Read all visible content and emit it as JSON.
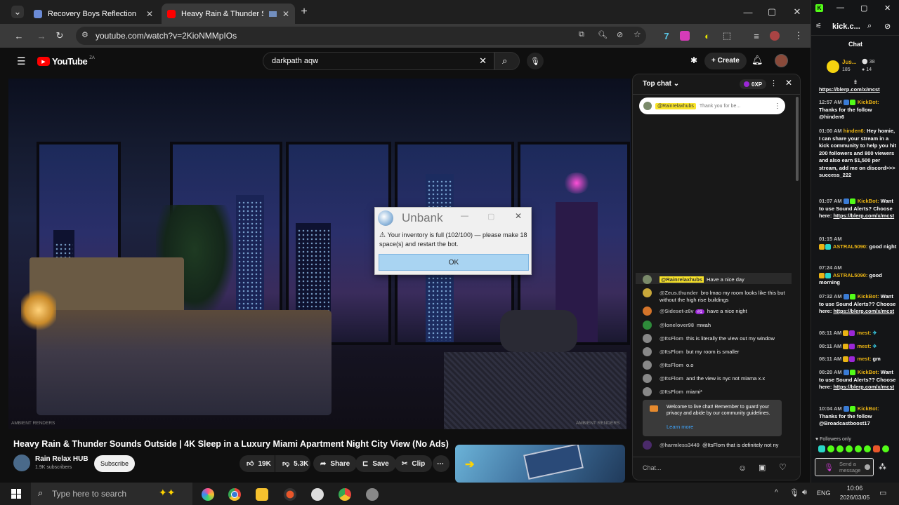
{
  "browser": {
    "tabs": [
      {
        "title": "Recovery Boys Reflection",
        "active": false
      },
      {
        "title": "Heavy Rain & Thunder Sou",
        "active": true
      }
    ],
    "url": "youtube.com/watch?v=2KioNMMpIOs"
  },
  "youtube": {
    "logo": "YouTube",
    "region": "ZA",
    "search_query": "darkpath aqw",
    "create_label": "Create",
    "video_watermark_left": "AMBIENT RENDERS",
    "video_watermark_right": "AMBIENT RENDERS",
    "video_title": "Heavy Rain & Thunder Sounds Outside | 4K Sleep in a Luxury Miami Apartment Night City View (No Ads)",
    "channel_name": "Rain Relax HUB",
    "subscribers": "1.9K subscribers",
    "subscribe_label": "Subscribe",
    "likes": "19K",
    "dislikes": "5.3K",
    "share_label": "Share",
    "save_label": "Save",
    "clip_label": "Clip"
  },
  "livechat": {
    "header": "Top chat",
    "points": "0XP",
    "pinned_user": "@Rainrelaxhubs",
    "pinned_msg": "Thank you for be...",
    "messages": [
      {
        "user": "@Rainrelaxhubs",
        "msg": "Have a nice day",
        "avatar_color": "#7a8a6a"
      },
      {
        "user": "@Zeus.thunder",
        "msg": "bro lmao my room looks like this but without the high rise buildings",
        "avatar_color": "#c9a83a"
      },
      {
        "user": "@Sideset-z6v",
        "msg": "have a nice night",
        "avatar_color": "#d4742a",
        "badge": "#1"
      },
      {
        "user": "@lonelover98",
        "msg": "mwah",
        "avatar_color": "#2e8b3a"
      },
      {
        "user": "@ItsFlom",
        "msg": "this is literally the view out my window",
        "avatar_color": "#888"
      },
      {
        "user": "@ItsFlom",
        "msg": "but my room is smaller",
        "avatar_color": "#888"
      },
      {
        "user": "@ItsFlom",
        "msg": "o.o",
        "avatar_color": "#888"
      },
      {
        "user": "@ItsFlom",
        "msg": "and the view is nyc not miama x.x",
        "avatar_color": "#888"
      },
      {
        "user": "@ItsFlom",
        "msg": "miami*",
        "avatar_color": "#888"
      }
    ],
    "welcome_text": "Welcome to live chat! Remember to guard your privacy and abide by our community guidelines.",
    "learn_more": "Learn more",
    "last_user": "@harmless3449",
    "last_msg": "@ItsFlom that is definitely not ny",
    "input_placeholder": "Chat..."
  },
  "dialog": {
    "title": "Unbank",
    "message": "Your inventory is full (102/100) — please make 18 space(s) and restart the bot.",
    "ok_label": "OK"
  },
  "kick": {
    "url": "kick.c...",
    "chat_label": "Chat",
    "user": "Jus...",
    "stat1": "38",
    "stat2": "185",
    "stat3": "14",
    "messages": [
      {
        "time": "",
        "user": "",
        "text": "https://blerp.com/x/mcst",
        "link": true
      },
      {
        "time": "12:57 AM",
        "user": "KickBot:",
        "text": "Thanks for the follow @hinden6"
      },
      {
        "time": "01:00 AM",
        "user": "hinden6:",
        "text": "Hey homie, I can share your stream in a kick community to help you hit 200 followers and 800 viewers and also earn $1,500 per stream, add me on discord>>> success_222"
      },
      {
        "time": "01:07 AM",
        "user": "KickBot:",
        "text": "Want to use Sound Alerts? Choose here:",
        "link_text": "https://blerp.com/x/mcst"
      },
      {
        "time": "01:15 AM",
        "user": "ASTRAL5090:",
        "text": "good night"
      },
      {
        "time": "07:24 AM",
        "user": "ASTRAL5090:",
        "text": "good morning"
      },
      {
        "time": "07:32 AM",
        "user": "KickBot:",
        "text": "Want to use Sound Alerts?? Choose here:",
        "link_text": "https://blerp.com/x/mcst"
      },
      {
        "time": "08:11 AM",
        "user": "mest:",
        "text": ""
      },
      {
        "time": "08:11 AM",
        "user": "mest:",
        "text": ""
      },
      {
        "time": "08:11 AM",
        "user": "mest:",
        "text": "gm"
      },
      {
        "time": "08:20 AM",
        "user": "KickBot:",
        "text": "Want to use Sound Alerts?? Choose here:",
        "link_text": "https://blerp.com/x/mcst"
      },
      {
        "time": "10:04 AM",
        "user": "KickBot:",
        "text": "Thanks for the follow @Broadcastboost17"
      }
    ],
    "followers_only": "Followers only",
    "send_placeholder": "Send a message"
  },
  "taskbar": {
    "search_placeholder": "Type here to search",
    "lang": "ENG",
    "time": "10:06",
    "date": "2026/03/05"
  },
  "colors": {
    "yt_red": "#ff0000",
    "kick_green": "#53fc18",
    "kickbot_gold": "#e9b314"
  }
}
